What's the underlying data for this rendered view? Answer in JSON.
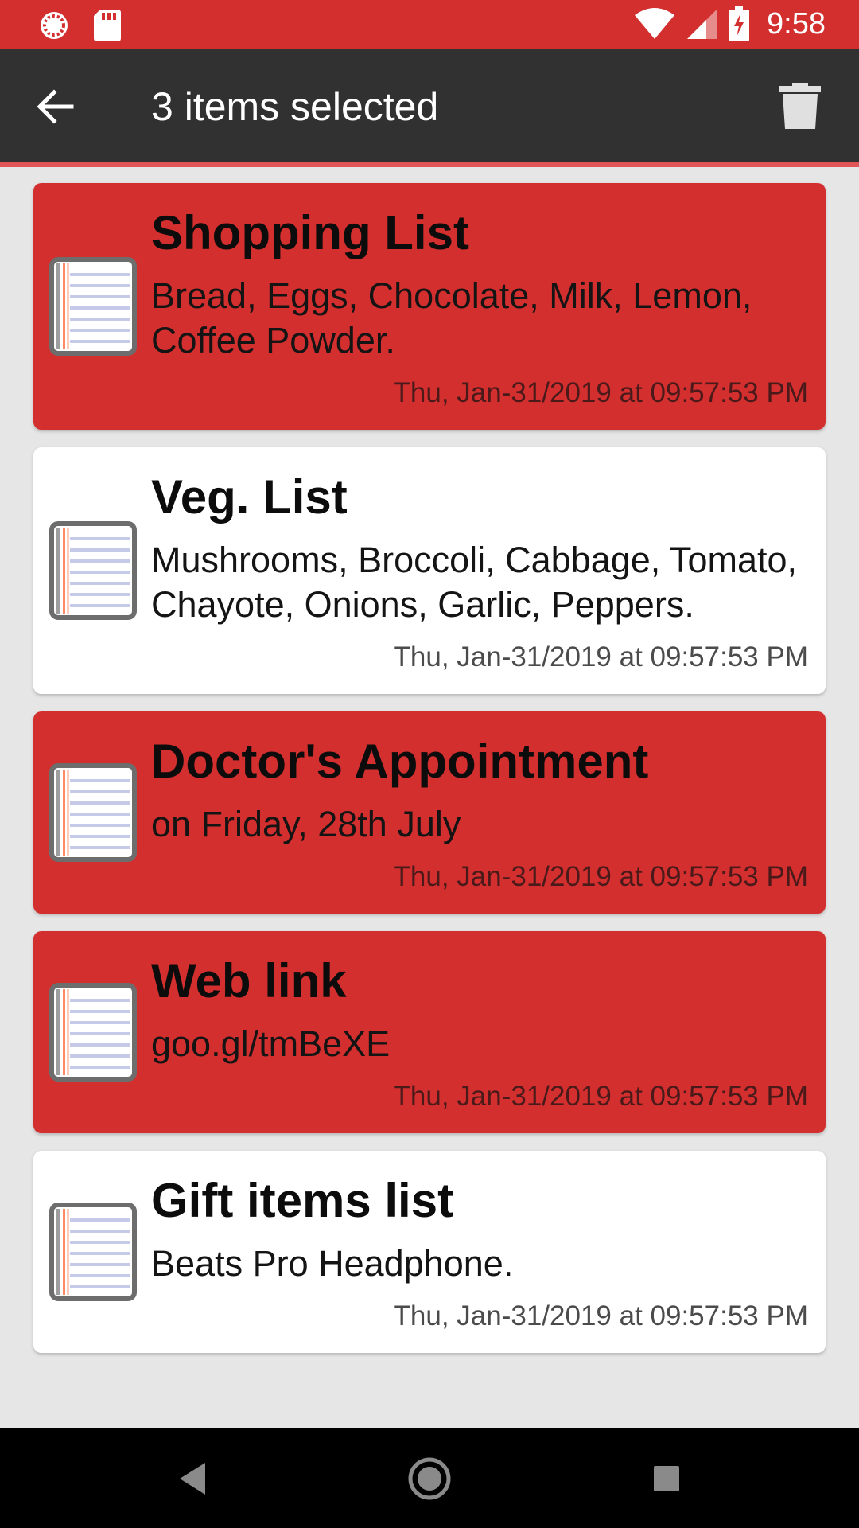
{
  "status_bar": {
    "time": "9:58",
    "icons": [
      "sync-icon",
      "sd-card-icon",
      "wifi-icon",
      "signal-icon",
      "battery-charging-icon"
    ]
  },
  "toolbar": {
    "title": "3 items selected",
    "back_icon": "arrow-back-icon",
    "delete_icon": "trash-icon"
  },
  "colors": {
    "accent": "#d32f2f",
    "toolbar": "#313131",
    "background": "#e6e6e6"
  },
  "notes": [
    {
      "title": "Shopping List",
      "body": "Bread, Eggs, Chocolate, Milk, Lemon, Coffee Powder.",
      "date": "Thu, Jan-31/2019 at 09:57:53 PM",
      "selected": true
    },
    {
      "title": "Veg. List",
      "body": "Mushrooms, Broccoli, Cabbage, Tomato, Chayote, Onions, Garlic, Peppers.",
      "date": "Thu, Jan-31/2019 at 09:57:53 PM",
      "selected": false
    },
    {
      "title": "Doctor's Appointment",
      "body": "on Friday, 28th July",
      "date": "Thu, Jan-31/2019 at 09:57:53 PM",
      "selected": true
    },
    {
      "title": "Web link",
      "body": "goo.gl/tmBeXE",
      "date": "Thu, Jan-31/2019 at 09:57:53 PM",
      "selected": true
    },
    {
      "title": "Gift items list",
      "body": "Beats Pro Headphone.",
      "date": "Thu, Jan-31/2019 at 09:57:53 PM",
      "selected": false
    }
  ],
  "nav_bar": {
    "icons": [
      "back-triangle-icon",
      "home-circle-icon",
      "recents-square-icon"
    ]
  }
}
